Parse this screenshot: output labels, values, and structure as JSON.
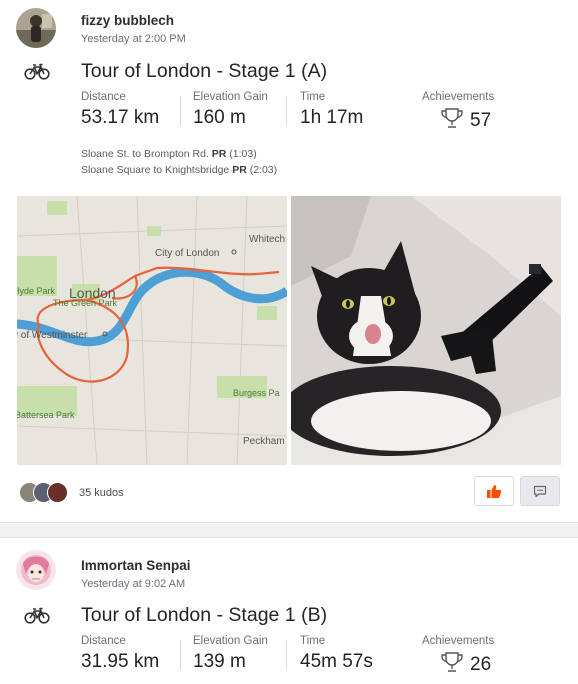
{
  "feed": [
    {
      "athlete": "fizzy bubblech",
      "time": "Yesterday at 2:00 PM",
      "activity_icon": "bike-icon",
      "title": "Tour of London - Stage 1 (A)",
      "stats": {
        "distance_label": "Distance",
        "distance": "53.17 km",
        "elevation_label": "Elevation Gain",
        "elevation": "160 m",
        "time_label": "Time",
        "time": "1h 17m",
        "achievements_label": "Achievements",
        "achievements": "57"
      },
      "segments": [
        {
          "name": "Sloane St. to Brompton Rd.",
          "pr": "PR",
          "pr_time": "(1:03)"
        },
        {
          "name": "Sloane Square to Knightsbridge",
          "pr": "PR",
          "pr_time": "(2:03)"
        }
      ],
      "map_labels": {
        "city": "City of London",
        "whitechapel": "Whitech",
        "hyde_park": "Hyde Park",
        "london": "London",
        "green_park": "The Green Park",
        "westminster": "y of Westminster",
        "burgess": "Burgess Pa",
        "battersea": "Battersea Park",
        "peckham": "Peckham"
      },
      "kudos": "35 kudos",
      "accent": "#fc4c02"
    },
    {
      "athlete": "Immortan Senpai",
      "time": "Yesterday at 9:02 AM",
      "activity_icon": "bike-icon",
      "title": "Tour of London - Stage 1 (B)",
      "stats": {
        "distance_label": "Distance",
        "distance": "31.95 km",
        "elevation_label": "Elevation Gain",
        "elevation": "139 m",
        "time_label": "Time",
        "time": "45m 57s",
        "achievements_label": "Achievements",
        "achievements": "26"
      }
    }
  ]
}
